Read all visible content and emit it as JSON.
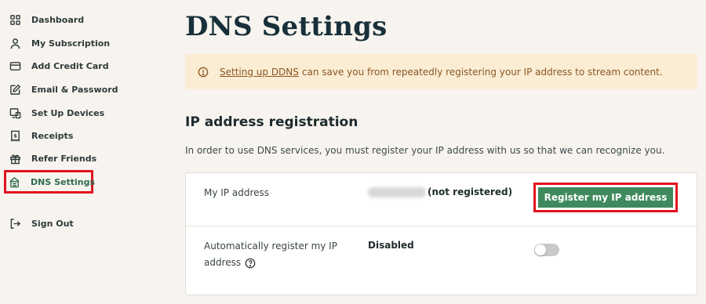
{
  "sidebar": {
    "items": [
      {
        "label": "Dashboard",
        "icon": "dashboard-icon"
      },
      {
        "label": "My Subscription",
        "icon": "user-icon"
      },
      {
        "label": "Add Credit Card",
        "icon": "credit-card-icon"
      },
      {
        "label": "Email & Password",
        "icon": "edit-icon"
      },
      {
        "label": "Set Up Devices",
        "icon": "devices-icon"
      },
      {
        "label": "Receipts",
        "icon": "receipt-icon"
      },
      {
        "label": "Refer Friends",
        "icon": "gift-icon"
      },
      {
        "label": "DNS Settings",
        "icon": "dns-icon",
        "active": true
      }
    ],
    "sign_out": {
      "label": "Sign Out",
      "icon": "sign-out-icon"
    }
  },
  "main": {
    "title": "DNS Settings",
    "alert": {
      "link": "Setting up DDNS",
      "text": "can save you from repeatedly registering your IP address to stream content."
    },
    "section_title": "IP address registration",
    "section_desc": "In order to use DNS services, you must register your IP address with us so that we can recognize you.",
    "ip_row": {
      "label": "My IP address",
      "status": "(not registered)",
      "button": "Register my IP address"
    },
    "auto_row": {
      "label": "Automatically register my IP address",
      "value": "Disabled",
      "toggle_on": false
    }
  },
  "colors": {
    "accent_green": "#3f8a5d",
    "highlight_red": "#e0121e",
    "alert_bg": "#fbecd4",
    "alert_text": "#8a5722"
  }
}
